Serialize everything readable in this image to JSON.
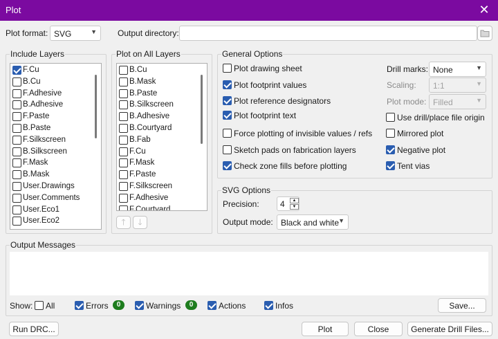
{
  "window": {
    "title": "Plot"
  },
  "top": {
    "plot_format_label": "Plot format:",
    "plot_format_value": "SVG",
    "output_dir_label": "Output directory:",
    "output_dir_value": ""
  },
  "include_layers": {
    "title": "Include Layers",
    "items": [
      {
        "label": "F.Cu",
        "checked": true
      },
      {
        "label": "B.Cu",
        "checked": false
      },
      {
        "label": "F.Adhesive",
        "checked": false
      },
      {
        "label": "B.Adhesive",
        "checked": false
      },
      {
        "label": "F.Paste",
        "checked": false
      },
      {
        "label": "B.Paste",
        "checked": false
      },
      {
        "label": "F.Silkscreen",
        "checked": false
      },
      {
        "label": "B.Silkscreen",
        "checked": false
      },
      {
        "label": "F.Mask",
        "checked": false
      },
      {
        "label": "B.Mask",
        "checked": false
      },
      {
        "label": "User.Drawings",
        "checked": false
      },
      {
        "label": "User.Comments",
        "checked": false
      },
      {
        "label": "User.Eco1",
        "checked": false
      },
      {
        "label": "User.Eco2",
        "checked": false
      }
    ]
  },
  "plot_all_layers": {
    "title": "Plot on All Layers",
    "items": [
      {
        "label": "B.Cu",
        "checked": false
      },
      {
        "label": "B.Mask",
        "checked": false
      },
      {
        "label": "B.Paste",
        "checked": false
      },
      {
        "label": "B.Silkscreen",
        "checked": false
      },
      {
        "label": "B.Adhesive",
        "checked": false
      },
      {
        "label": "B.Courtyard",
        "checked": false
      },
      {
        "label": "B.Fab",
        "checked": false
      },
      {
        "label": "F.Cu",
        "checked": false
      },
      {
        "label": "F.Mask",
        "checked": false
      },
      {
        "label": "F.Paste",
        "checked": false
      },
      {
        "label": "F.Silkscreen",
        "checked": false
      },
      {
        "label": "F.Adhesive",
        "checked": false
      },
      {
        "label": "F.Courtyard",
        "checked": false
      }
    ],
    "up_icon": "arrow-up-icon",
    "down_icon": "arrow-down-icon"
  },
  "general": {
    "title": "General Options",
    "left_options": [
      {
        "label": "Plot drawing sheet",
        "checked": false
      },
      {
        "label": "Plot footprint values",
        "checked": true
      },
      {
        "label": "Plot reference designators",
        "checked": true
      },
      {
        "label": "Plot footprint text",
        "checked": true
      },
      {
        "label": "Force plotting of invisible values / refs",
        "checked": false
      },
      {
        "label": "Sketch pads on fabrication layers",
        "checked": false
      },
      {
        "label": "Check zone fills before plotting",
        "checked": true
      }
    ],
    "drill_marks_label": "Drill marks:",
    "drill_marks_value": "None",
    "scaling_label": "Scaling:",
    "scaling_value": "1:1",
    "plot_mode_label": "Plot mode:",
    "plot_mode_value": "Filled",
    "right_options": [
      {
        "label": "Use drill/place file origin",
        "checked": false
      },
      {
        "label": "Mirrored plot",
        "checked": false
      },
      {
        "label": "Negative plot",
        "checked": true
      },
      {
        "label": "Tent vias",
        "checked": true
      }
    ]
  },
  "svg": {
    "title": "SVG Options",
    "precision_label": "Precision:",
    "precision_value": "4",
    "output_mode_label": "Output mode:",
    "output_mode_value": "Black and white"
  },
  "messages": {
    "title": "Output Messages",
    "show_label": "Show:",
    "filters": [
      {
        "label": "All",
        "checked": false
      },
      {
        "label": "Errors",
        "checked": true,
        "count": "0"
      },
      {
        "label": "Warnings",
        "checked": true,
        "count": "0"
      },
      {
        "label": "Actions",
        "checked": true
      },
      {
        "label": "Infos",
        "checked": true
      }
    ],
    "save_label": "Save..."
  },
  "buttons": {
    "run_drc": "Run DRC...",
    "plot": "Plot",
    "close": "Close",
    "gen_drill": "Generate Drill Files..."
  },
  "colors": {
    "titlebar": "#7b0aa0",
    "checkbox_on": "#2a5db0",
    "badge": "#1e7d1e"
  }
}
